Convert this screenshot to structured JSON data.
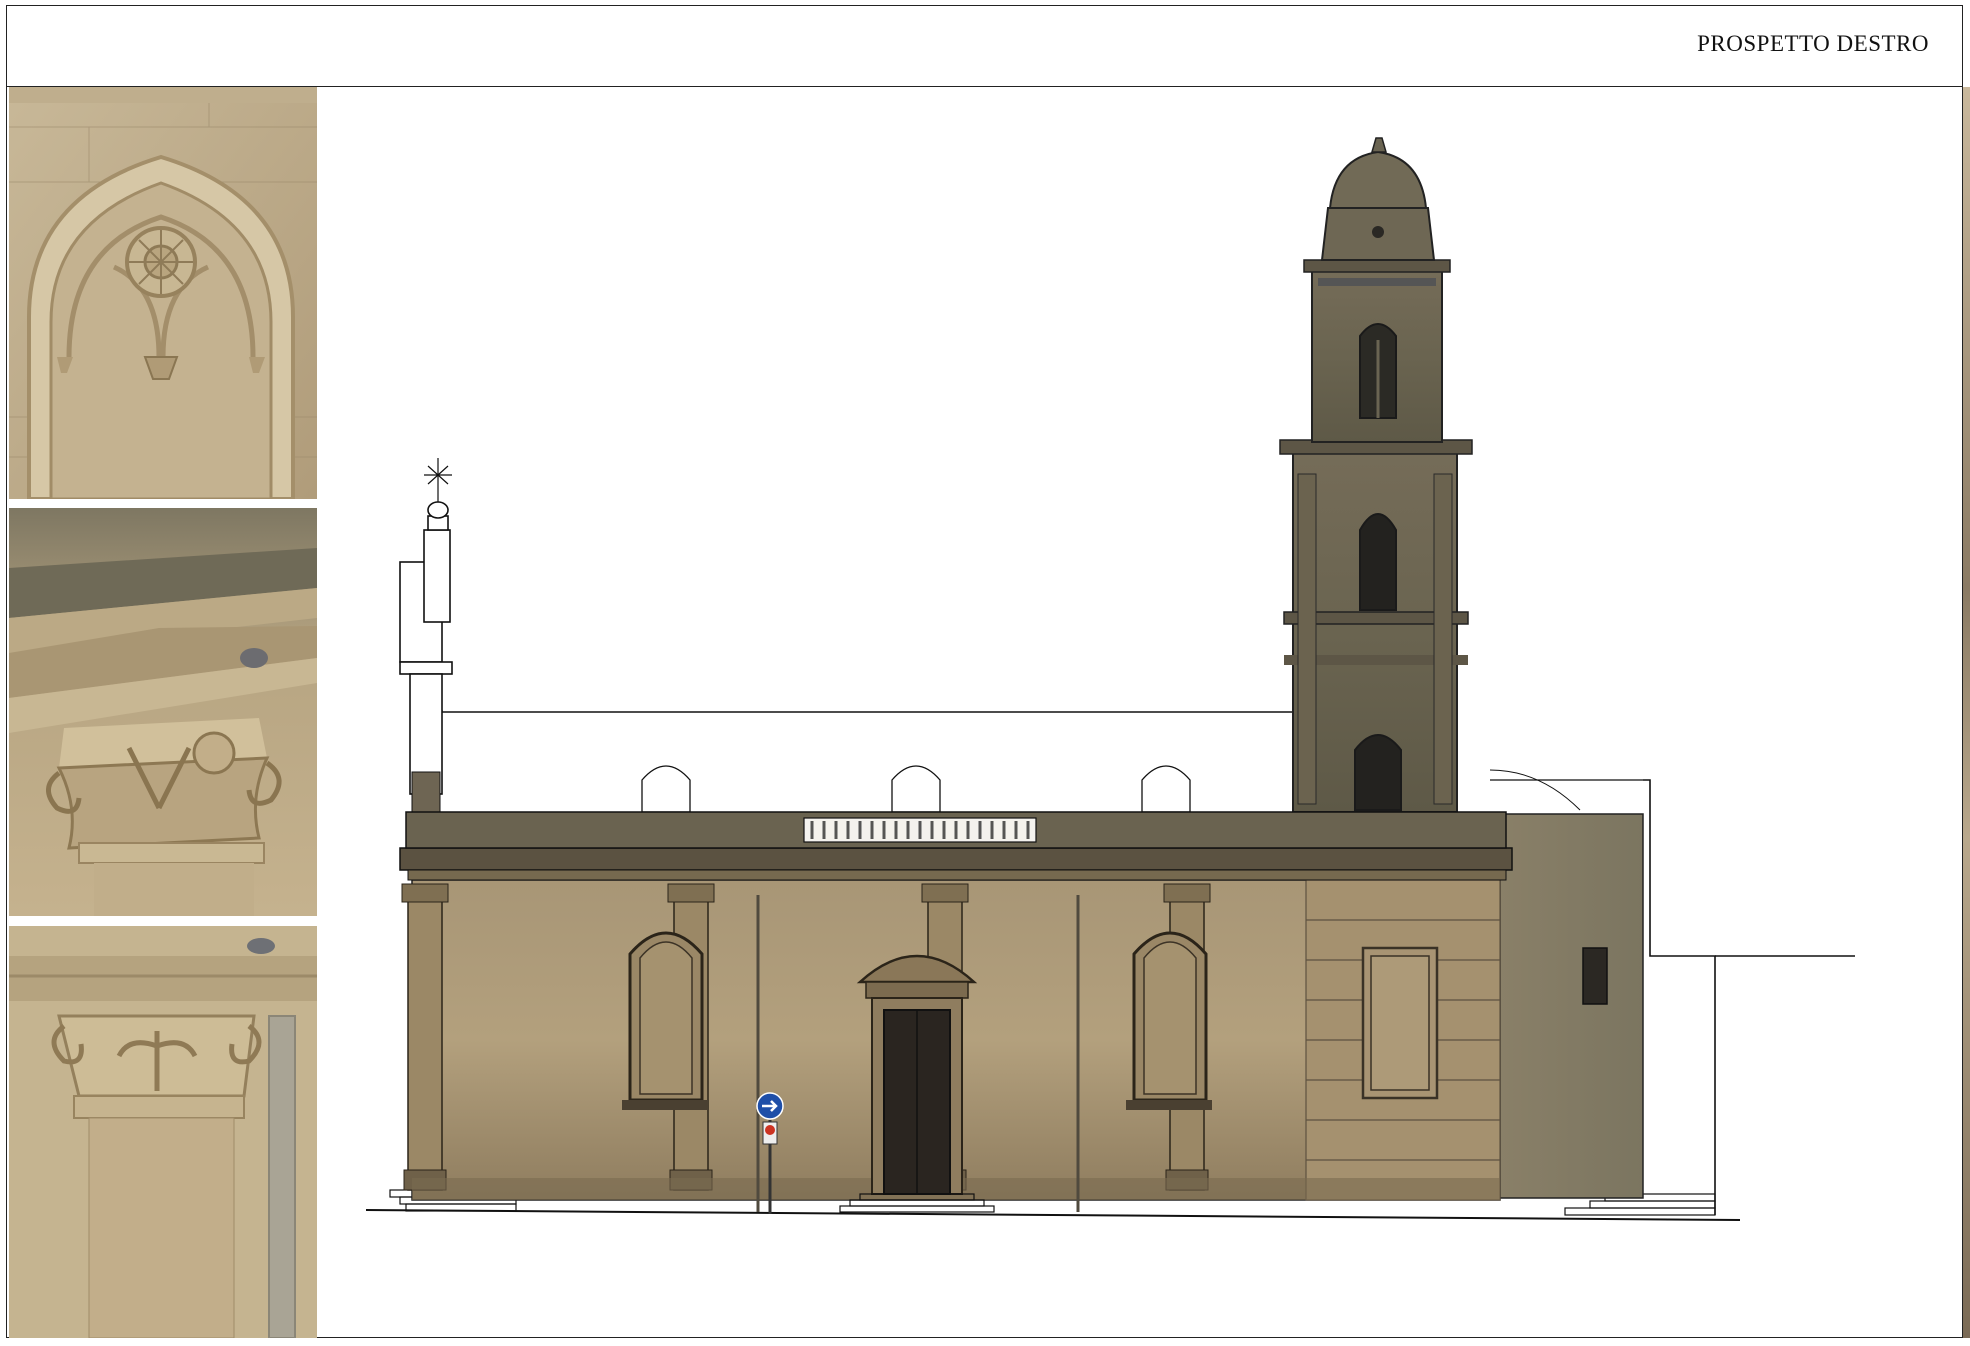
{
  "sheet": {
    "title": "PROSPETTO DESTRO"
  },
  "details": [
    {
      "subject": "gothic-arch-with-rose-window"
    },
    {
      "subject": "corinthian-capital-corner"
    },
    {
      "subject": "corinthian-capital-pilaster"
    }
  ],
  "colors": {
    "stone": "#b5a37f",
    "stone_dark": "#6f644f",
    "tower_stone": "#6d6652",
    "line": "#111111"
  }
}
